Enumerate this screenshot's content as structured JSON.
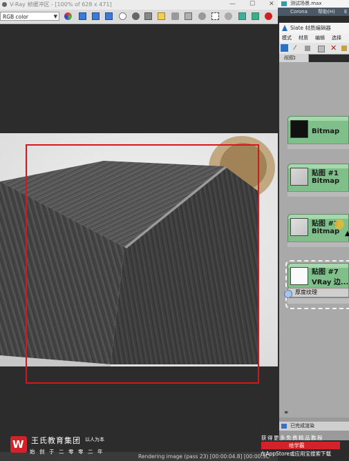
{
  "vfb": {
    "title": "V-Ray 帧缓冲区 - [100% of 628 x 471]",
    "channel": "RGB color",
    "status": "Rendering image (pass 23) [00:00:04.8] [00:00:3C"
  },
  "host": {
    "title": "测试场景.max",
    "menu": [
      "Corona",
      "帮助(H)",
      "E"
    ]
  },
  "slate": {
    "title": "Slate 材质编辑器",
    "menu": [
      "模式",
      "材质",
      "编辑",
      "选择"
    ],
    "view_tab": "视图1",
    "status": "已完成渲染",
    "nodes": [
      {
        "title": "",
        "subtitle": "Bitmap"
      },
      {
        "title": "贴图 #1",
        "subtitle": "Bitmap"
      },
      {
        "title": "贴图 #2",
        "subtitle": "Bitmap"
      },
      {
        "title": "贴图 #7",
        "subtitle": "VRay 边...",
        "slot": "厚度纹理"
      }
    ]
  },
  "watermark": {
    "brand": "王氏教育集团",
    "motto": "以人为本",
    "tagline": "始创于二零零二年",
    "promo_line1": "获得更多免费精品教程",
    "promo_button": "绘学霸",
    "promo_line2": "在AppStore或应用宝搜索下载"
  }
}
